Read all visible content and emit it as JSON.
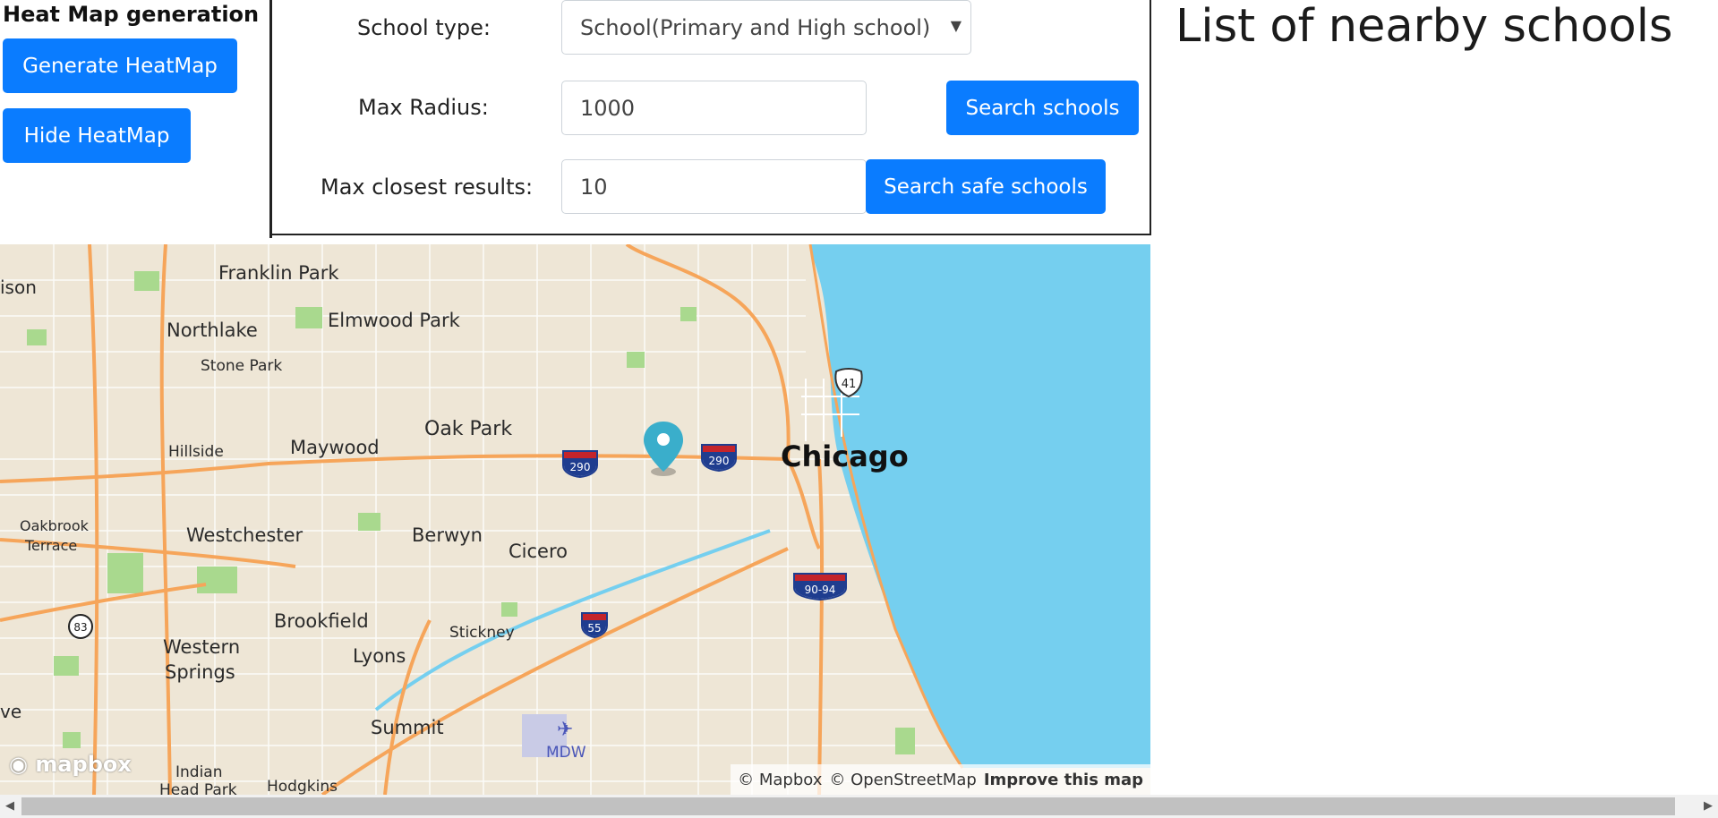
{
  "heatmap": {
    "title": "Heat Map generation",
    "generate_label": "Generate HeatMap",
    "hide_label": "Hide HeatMap"
  },
  "form": {
    "school_type_label": "School type:",
    "school_type_value": "School(Primary and High school)",
    "max_radius_label": "Max Radius:",
    "max_radius_value": "1000",
    "max_results_label": "Max closest results:",
    "max_results_value": "10",
    "search_label": "Search schools",
    "search_safe_label": "Search safe schools"
  },
  "list": {
    "title": "List of nearby schools"
  },
  "map": {
    "labels": {
      "franklin_park": "Franklin Park",
      "ison": "ison",
      "northlake": "Northlake",
      "elmwood_park": "Elmwood Park",
      "stone_park": "Stone Park",
      "oak_park": "Oak Park",
      "maywood": "Maywood",
      "hillside": "Hillside",
      "chicago": "Chicago",
      "oakbrook_terrace_1": "Oakbrook",
      "oakbrook_terrace_2": "Terrace",
      "westchester": "Westchester",
      "berwyn": "Berwyn",
      "cicero": "Cicero",
      "brookfield": "Brookfield",
      "stickney": "Stickney",
      "western_springs_1": "Western",
      "western_springs_2": "Springs",
      "lyons": "Lyons",
      "summit": "Summit",
      "ve": "ve",
      "indian_head_park_1": "Indian",
      "indian_head_park_2": "Head Park",
      "hodgkins": "Hodgkins",
      "mdw": "MDW"
    },
    "shields": {
      "i290_left": "290",
      "i290_right": "290",
      "us41": "41",
      "i9094": "90-94",
      "i55": "55",
      "r83": "83"
    },
    "logo_text": "mapbox",
    "attribution": {
      "mapbox": "© Mapbox",
      "osm": "© OpenStreetMap",
      "improve": "Improve this map"
    },
    "colors": {
      "land": "#eee6d6",
      "water": "#75cfef",
      "highway": "#f6a55a",
      "park": "#a9d98e",
      "marker": "#3aaecb"
    }
  }
}
